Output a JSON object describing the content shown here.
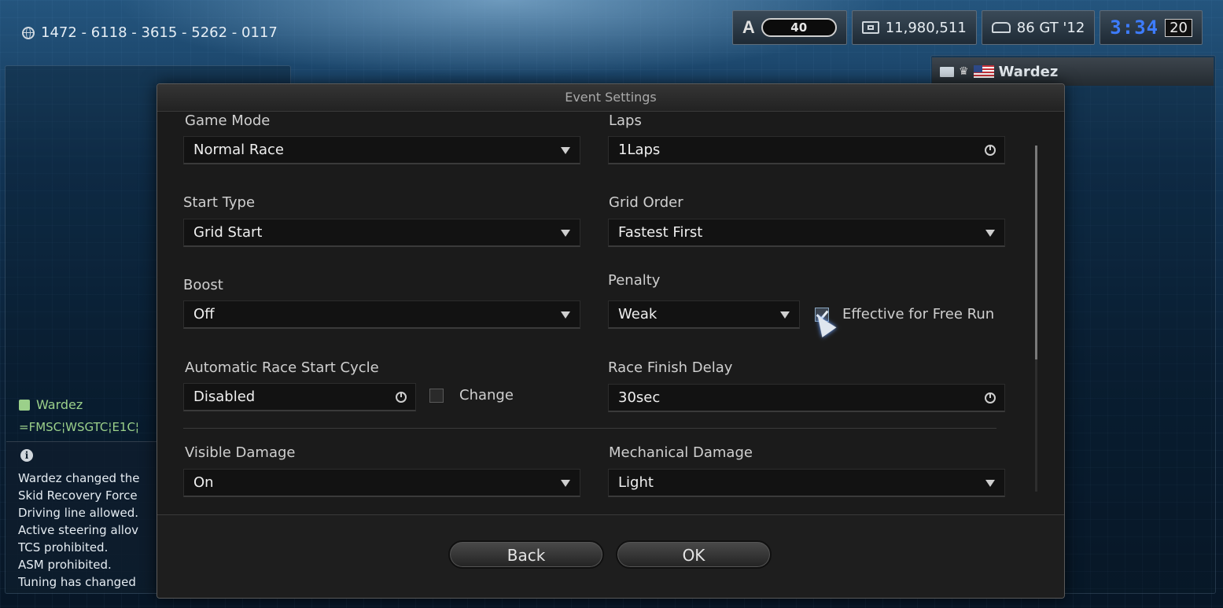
{
  "header": {
    "room_code": "1472 - 6118 - 3615 - 5262 - 0117",
    "rank_letter": "A",
    "rank_level": "40",
    "credits": "11,980,511",
    "car": "86 GT '12",
    "time": "3:34",
    "players": "20"
  },
  "player_list": {
    "player_name": "Wardez"
  },
  "chat": {
    "sender": "Wardez",
    "message": "=FMSC¦WSGTC¦E1C¦"
  },
  "log": {
    "lines": [
      "Wardez changed the",
      "Skid Recovery Force",
      "Driving line allowed.",
      "Active steering allov",
      "TCS prohibited.",
      "ASM prohibited.",
      "Tuning has changed"
    ]
  },
  "dialog": {
    "title": "Event Settings",
    "game_mode": {
      "label": "Game Mode",
      "value": "Normal Race"
    },
    "laps": {
      "label": "Laps",
      "value": "1Laps"
    },
    "start_type": {
      "label": "Start Type",
      "value": "Grid Start"
    },
    "grid_order": {
      "label": "Grid Order",
      "value": "Fastest First"
    },
    "boost": {
      "label": "Boost",
      "value": "Off"
    },
    "penalty": {
      "label": "Penalty",
      "value": "Weak"
    },
    "free_run": {
      "label": "Effective for Free Run",
      "checked": true
    },
    "auto_start": {
      "label": "Automatic Race Start Cycle",
      "value": "Disabled"
    },
    "change": {
      "label": "Change",
      "checked": false
    },
    "finish_delay": {
      "label": "Race Finish Delay",
      "value": "30sec"
    },
    "visible_damage": {
      "label": "Visible Damage",
      "value": "On"
    },
    "mechanical_damage": {
      "label": "Mechanical Damage",
      "value": "Light"
    },
    "back_label": "Back",
    "ok_label": "OK"
  }
}
